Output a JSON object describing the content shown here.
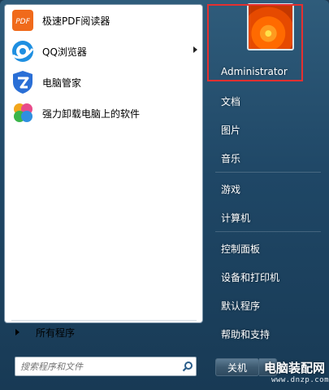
{
  "programs": [
    {
      "label": "极速PDF阅读器",
      "icon": "pdf-reader-icon",
      "icon_text": "PDF",
      "color": "#f06a1b",
      "has_submenu": false
    },
    {
      "label": "QQ浏览器",
      "icon": "qq-browser-icon",
      "color": "#1e8fe1",
      "has_submenu": true
    },
    {
      "label": "电脑管家",
      "icon": "pc-manager-icon",
      "color": "#2a6fd6",
      "has_submenu": false
    },
    {
      "label": "强力卸载电脑上的软件",
      "icon": "uninstaller-icon",
      "color": "#e84b8a",
      "has_submenu": false
    }
  ],
  "all_programs": {
    "label": "所有程序"
  },
  "search": {
    "placeholder": "搜索程序和文件"
  },
  "user": {
    "name": "Administrator",
    "avatar_icon": "flower-avatar-icon"
  },
  "right_links": [
    {
      "label": "文档"
    },
    {
      "label": "图片"
    },
    {
      "label": "音乐"
    },
    {
      "label": "游戏"
    },
    {
      "label": "计算机"
    },
    {
      "label": "控制面板"
    },
    {
      "label": "设备和打印机"
    },
    {
      "label": "默认程序"
    },
    {
      "label": "帮助和支持"
    }
  ],
  "shutdown": {
    "label": "关机"
  },
  "watermark": {
    "text": "电脑装配网",
    "url": "www.dnzp.com"
  },
  "colors": {
    "highlight_box": "#e53030",
    "menu_bg": "#1f4766"
  }
}
